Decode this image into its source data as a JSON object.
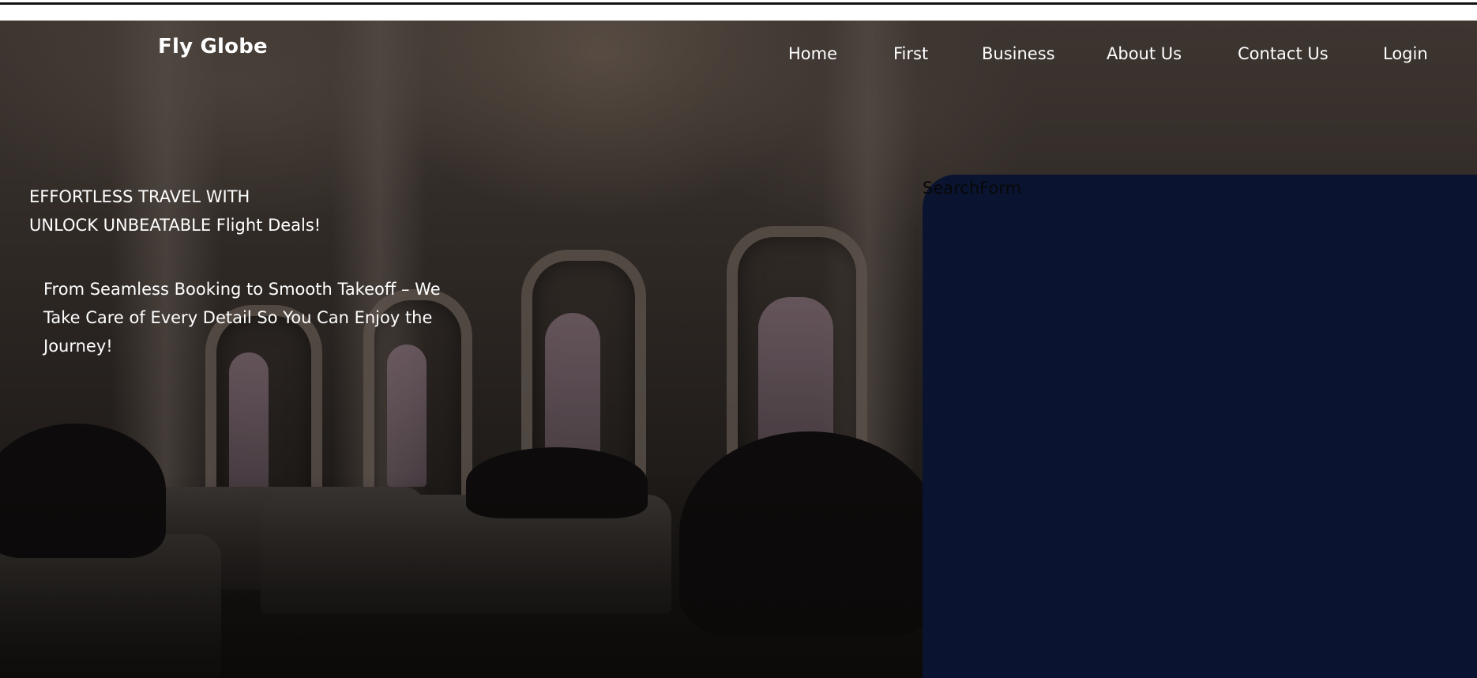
{
  "brand": "Fly Globe",
  "nav": {
    "home": "Home",
    "first": "First",
    "business": "Business",
    "about": "About Us",
    "contact": "Contact Us",
    "login": "Login"
  },
  "hero": {
    "line1": "EFFORTLESS TRAVEL WITH",
    "line2": "UNLOCK UNBEATABLE Flight Deals!",
    "subtitle": "From Seamless Booking to Smooth Takeoff – We Take Care of Every Detail So You Can Enjoy the Journey!"
  },
  "search": {
    "label": "SearchForm"
  },
  "colors": {
    "panel": "#0a1430",
    "text": "#ffffff"
  }
}
